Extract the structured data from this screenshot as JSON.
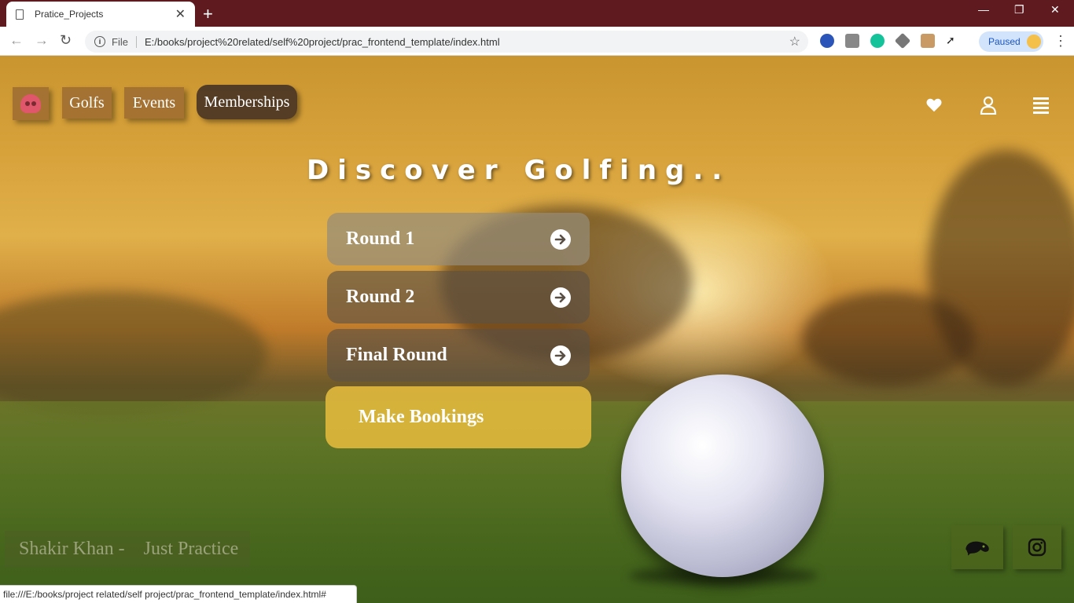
{
  "browser": {
    "tab_title": "Pratice_Projects",
    "file_label": "File",
    "url": "E:/books/project%20related/self%20project/prac_frontend_template/index.html",
    "paused_label": "Paused",
    "status_url": "file:///E:/books/project related/self project/prac_frontend_template/index.html#"
  },
  "nav": {
    "links": [
      {
        "label": "Golfs"
      },
      {
        "label": "Events"
      },
      {
        "label": "Memberships"
      }
    ],
    "icons": [
      "heart-icon",
      "user-icon",
      "menu-icon"
    ]
  },
  "hero": {
    "title": "Discover Golfing.."
  },
  "rounds": [
    {
      "label": "Round 1"
    },
    {
      "label": "Round 2"
    },
    {
      "label": "Final Round"
    }
  ],
  "booking": {
    "label": "Make Bookings"
  },
  "footer": {
    "credit": "Shakir Khan -    Just Practice"
  },
  "colors": {
    "tabbar": "#5e1a1f",
    "booking": "#e1b93c",
    "skull": "#e0566b"
  }
}
